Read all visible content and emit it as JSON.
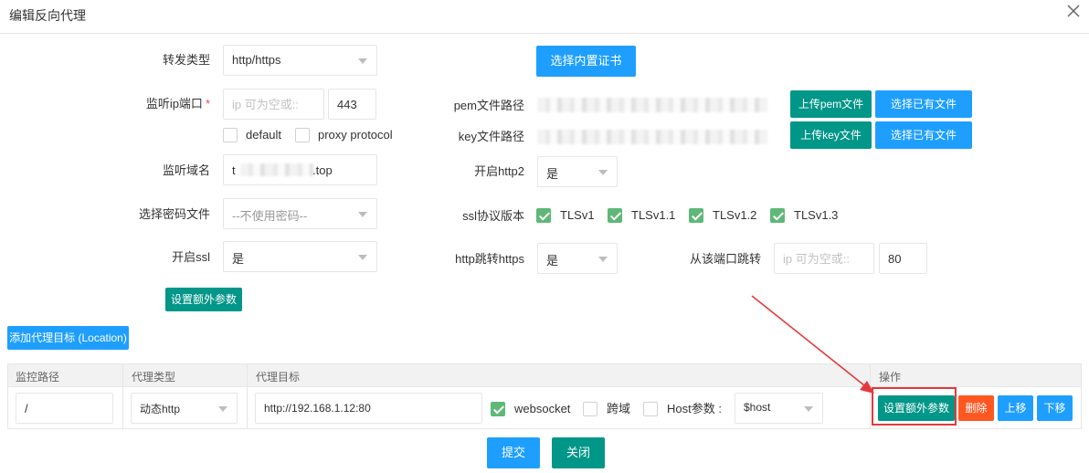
{
  "dialog": {
    "title": "编辑反向代理"
  },
  "form": {
    "forward_type": {
      "label": "转发类型",
      "value": "http/https"
    },
    "builtin_cert_button": "选择内置证书",
    "listen_port": {
      "label": "监听ip端口",
      "required_mark": "*",
      "ip_placeholder": "ip 可为空或::",
      "port": "443"
    },
    "default_checkbox": {
      "label": "default",
      "checked": false
    },
    "proxy_protocol_checkbox": {
      "label": "proxy protocol",
      "checked": false
    },
    "pem_path": {
      "label": "pem文件路径",
      "upload_button": "上传pem文件",
      "choose_button": "选择已有文件"
    },
    "key_path": {
      "label": "key文件路径",
      "upload_button": "上传key文件",
      "choose_button": "选择已有文件"
    },
    "listen_domain": {
      "label": "监听域名",
      "prefix": "t",
      "suffix": ".top"
    },
    "enable_http2": {
      "label": "开启http2",
      "value": "是"
    },
    "password_file": {
      "label": "选择密码文件",
      "value": "--不使用密码--"
    },
    "ssl_versions": {
      "label": "ssl协议版本",
      "options": [
        {
          "label": "TLSv1",
          "checked": true
        },
        {
          "label": "TLSv1.1",
          "checked": true
        },
        {
          "label": "TLSv1.2",
          "checked": true
        },
        {
          "label": "TLSv1.3",
          "checked": true
        }
      ]
    },
    "enable_ssl": {
      "label": "开启ssl",
      "value": "是"
    },
    "http_to_https": {
      "label": "http跳转https",
      "value": "是"
    },
    "redirect_from_port": {
      "label": "从该端口跳转",
      "ip_placeholder": "ip 可为空或::",
      "port": "80"
    },
    "extra_params_button": "设置额外参数"
  },
  "add_location_button": "添加代理目标 (Location)",
  "table": {
    "headers": [
      "监控路径",
      "代理类型",
      "代理目标",
      "操作"
    ],
    "row": {
      "path": "/",
      "proxy_type": "动态http",
      "target": "http://192.168.1.12:80",
      "websocket": {
        "label": "websocket",
        "checked": true
      },
      "cross_domain": {
        "label": "跨域",
        "checked": false
      },
      "host_param": {
        "label": "Host参数 :",
        "checked": false,
        "value": "$host"
      },
      "actions": {
        "extra": "设置额外参数",
        "delete": "删除",
        "move_up": "上移",
        "move_down": "下移"
      }
    }
  },
  "footer": {
    "submit": "提交",
    "close": "关闭"
  },
  "colors": {
    "teal": "#009688",
    "blue": "#1e9fff",
    "red": "#ff5722",
    "checkbox_green": "#5fb878",
    "annotation_red": "#e4393c"
  }
}
